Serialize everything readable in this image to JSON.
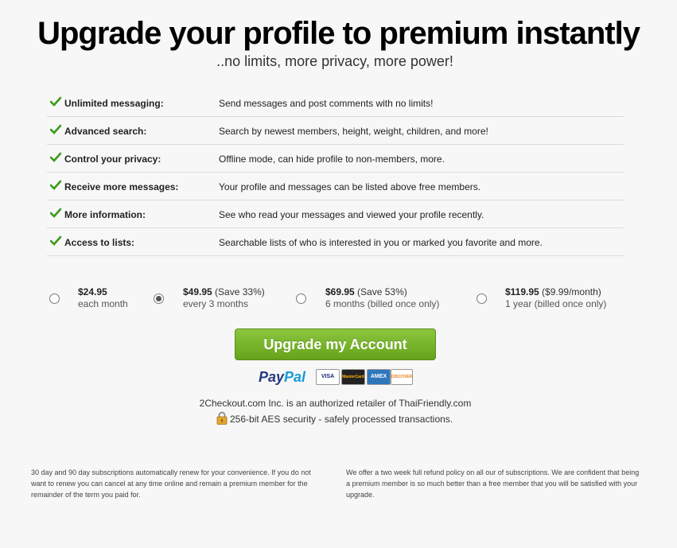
{
  "header": {
    "title": "Upgrade your profile to premium instantly",
    "subtitle": "..no limits, more privacy, more power!"
  },
  "features": [
    {
      "name": "Unlimited messaging:",
      "desc": "Send messages and post comments with no limits!"
    },
    {
      "name": "Advanced search:",
      "desc": "Search by newest members, height, weight, children, and more!"
    },
    {
      "name": "Control your privacy:",
      "desc": "Offline mode, can hide profile to non-members, more."
    },
    {
      "name": "Receive more messages:",
      "desc": "Your profile and messages can be listed above free members."
    },
    {
      "name": "More information:",
      "desc": "See who read your messages and viewed your profile recently."
    },
    {
      "name": "Access to lists:",
      "desc": "Searchable lists of who is interested in you or marked you favorite and more."
    }
  ],
  "plans": [
    {
      "price": "$24.95",
      "note": "",
      "sub": "each month",
      "selected": false
    },
    {
      "price": "$49.95",
      "note": " (Save 33%)",
      "sub": "every 3 months",
      "selected": true
    },
    {
      "price": "$69.95",
      "note": " (Save 53%)",
      "sub": "6 months (billed once only)",
      "selected": false
    },
    {
      "price": "$119.95",
      "note": " ($9.99/month)",
      "sub": "1 year (billed once only)",
      "selected": false
    }
  ],
  "cta": {
    "label": "Upgrade my Account"
  },
  "payments": {
    "paypal_a": "Pay",
    "paypal_b": "Pal",
    "visa": "VISA",
    "mastercard": "MasterCard",
    "amex": "AMEX",
    "discover": "DISCOVER"
  },
  "retailer_text": "2Checkout.com Inc. is an authorized retailer of ThaiFriendly.com",
  "security_text": "256-bit AES security - safely processed transactions.",
  "fine_print": {
    "left": "30 day and 90 day subscriptions automatically renew for your convenience. If you do not want to renew you can cancel at any time online and remain a premium member for the remainder of the term you paid for.",
    "right": "We offer a two week full refund policy on all our of subscriptions. We are confident that being a premium member is so much better than a free member that you will be satisfied with your upgrade."
  },
  "colors": {
    "accent_green": "#76b52a",
    "check_green": "#3a9a1a"
  },
  "icons": [
    "check-icon",
    "lock-icon",
    "paypal-logo",
    "visa-card-icon",
    "mastercard-icon",
    "amex-card-icon",
    "discover-card-icon"
  ]
}
